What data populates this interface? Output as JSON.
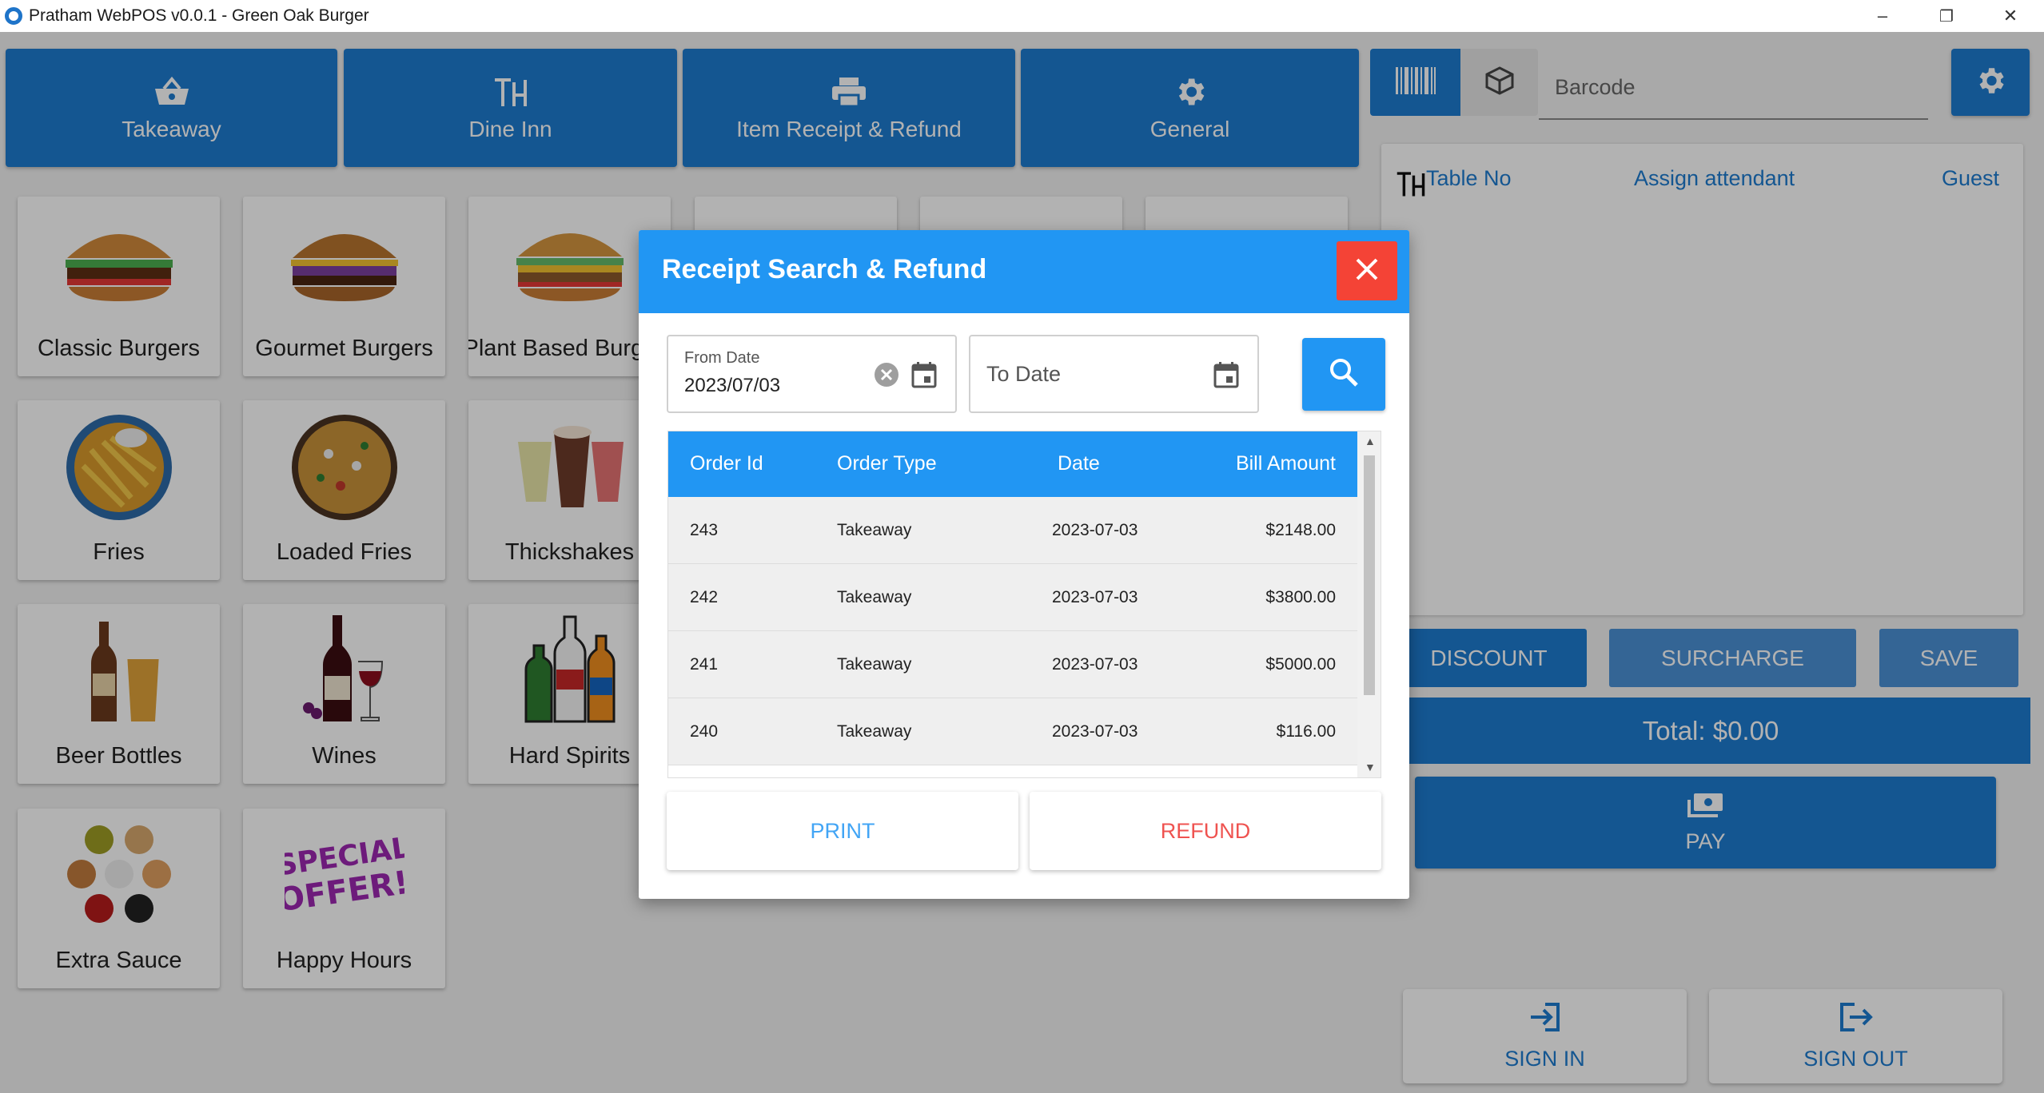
{
  "window": {
    "title": "Pratham WebPOS v0.0.1 - Green Oak Burger",
    "minimize": "–",
    "restore": "❐",
    "close": "✕"
  },
  "nav": [
    {
      "label": "Takeaway",
      "icon": "basket-icon"
    },
    {
      "label": "Dine Inn",
      "icon": "table-icon"
    },
    {
      "label": "Item Receipt & Refund",
      "icon": "printer-icon"
    },
    {
      "label": "General",
      "icon": "gear-icon"
    }
  ],
  "categories": [
    {
      "label": "Classic Burgers"
    },
    {
      "label": "Gourmet Burgers"
    },
    {
      "label": "Plant Based Burgers"
    },
    {
      "label": "Fries"
    },
    {
      "label": "Loaded Fries"
    },
    {
      "label": "Thickshakes"
    },
    {
      "label": "Beer Bottles"
    },
    {
      "label": "Wines"
    },
    {
      "label": "Hard Spirits"
    },
    {
      "label": "Extra Sauce"
    },
    {
      "label": "Happy Hours"
    }
  ],
  "special_offer": {
    "line1": "SPECIAL",
    "line2": "OFFER!"
  },
  "barcode": {
    "placeholder": "Barcode"
  },
  "order": {
    "table_no": "Table No",
    "assign_attendant": "Assign attendant",
    "guest": "Guest"
  },
  "actions": {
    "discount": "DISCOUNT",
    "surcharge": "SURCHARGE",
    "save": "SAVE"
  },
  "total": "Total: $0.00",
  "pay": "PAY",
  "sign_in": "SIGN IN",
  "sign_out": "SIGN OUT",
  "dialog": {
    "title": "Receipt Search & Refund",
    "from_date_label": "From Date",
    "from_date_value": "2023/07/03",
    "to_date_placeholder": "To Date",
    "columns": [
      "Order Id",
      "Order Type",
      "Date",
      "Bill Amount"
    ],
    "rows": [
      {
        "id": "243",
        "type": "Takeaway",
        "date": "2023-07-03",
        "amount": "$2148.00"
      },
      {
        "id": "242",
        "type": "Takeaway",
        "date": "2023-07-03",
        "amount": "$3800.00"
      },
      {
        "id": "241",
        "type": "Takeaway",
        "date": "2023-07-03",
        "amount": "$5000.00"
      },
      {
        "id": "240",
        "type": "Takeaway",
        "date": "2023-07-03",
        "amount": "$116.00"
      }
    ],
    "print": "PRINT",
    "refund": "REFUND"
  },
  "colors": {
    "primary": "#1e7bd0",
    "dialog_primary": "#2196f3",
    "close_red": "#f44336",
    "print_text": "#42a5f5",
    "refund_text": "#ef5350"
  }
}
